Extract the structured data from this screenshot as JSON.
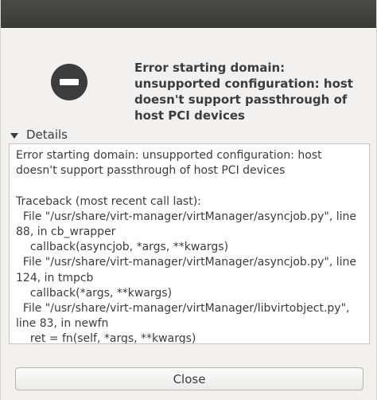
{
  "dialog": {
    "headline": "Error starting domain:\nunsupported configuration: host\ndoesn't support passthrough of\nhost PCI devices",
    "icon": "error-icon",
    "details_label": "Details",
    "details_text": "Error starting domain: unsupported configuration: host\ndoesn't support passthrough of host PCI devices\n\nTraceback (most recent call last):\n  File \"/usr/share/virt-manager/virtManager/asyncjob.py\", line\n88, in cb_wrapper\n    callback(asyncjob, *args, **kwargs)\n  File \"/usr/share/virt-manager/virtManager/asyncjob.py\", line\n124, in tmpcb\n    callback(*args, **kwargs)\n  File \"/usr/share/virt-manager/virtManager/libvirtobject.py\",\nline 83, in newfn\n    ret = fn(self, *args, **kwargs)\n  File \"/usr/share/virt-manager/virtManager/domain.py\", line",
    "close_label": "Close"
  },
  "colors": {
    "titlebar": "#3c3b37",
    "dialog_bg": "#f2f1f0",
    "icon": "#3c3c3c",
    "text": "#3c3c3c"
  }
}
